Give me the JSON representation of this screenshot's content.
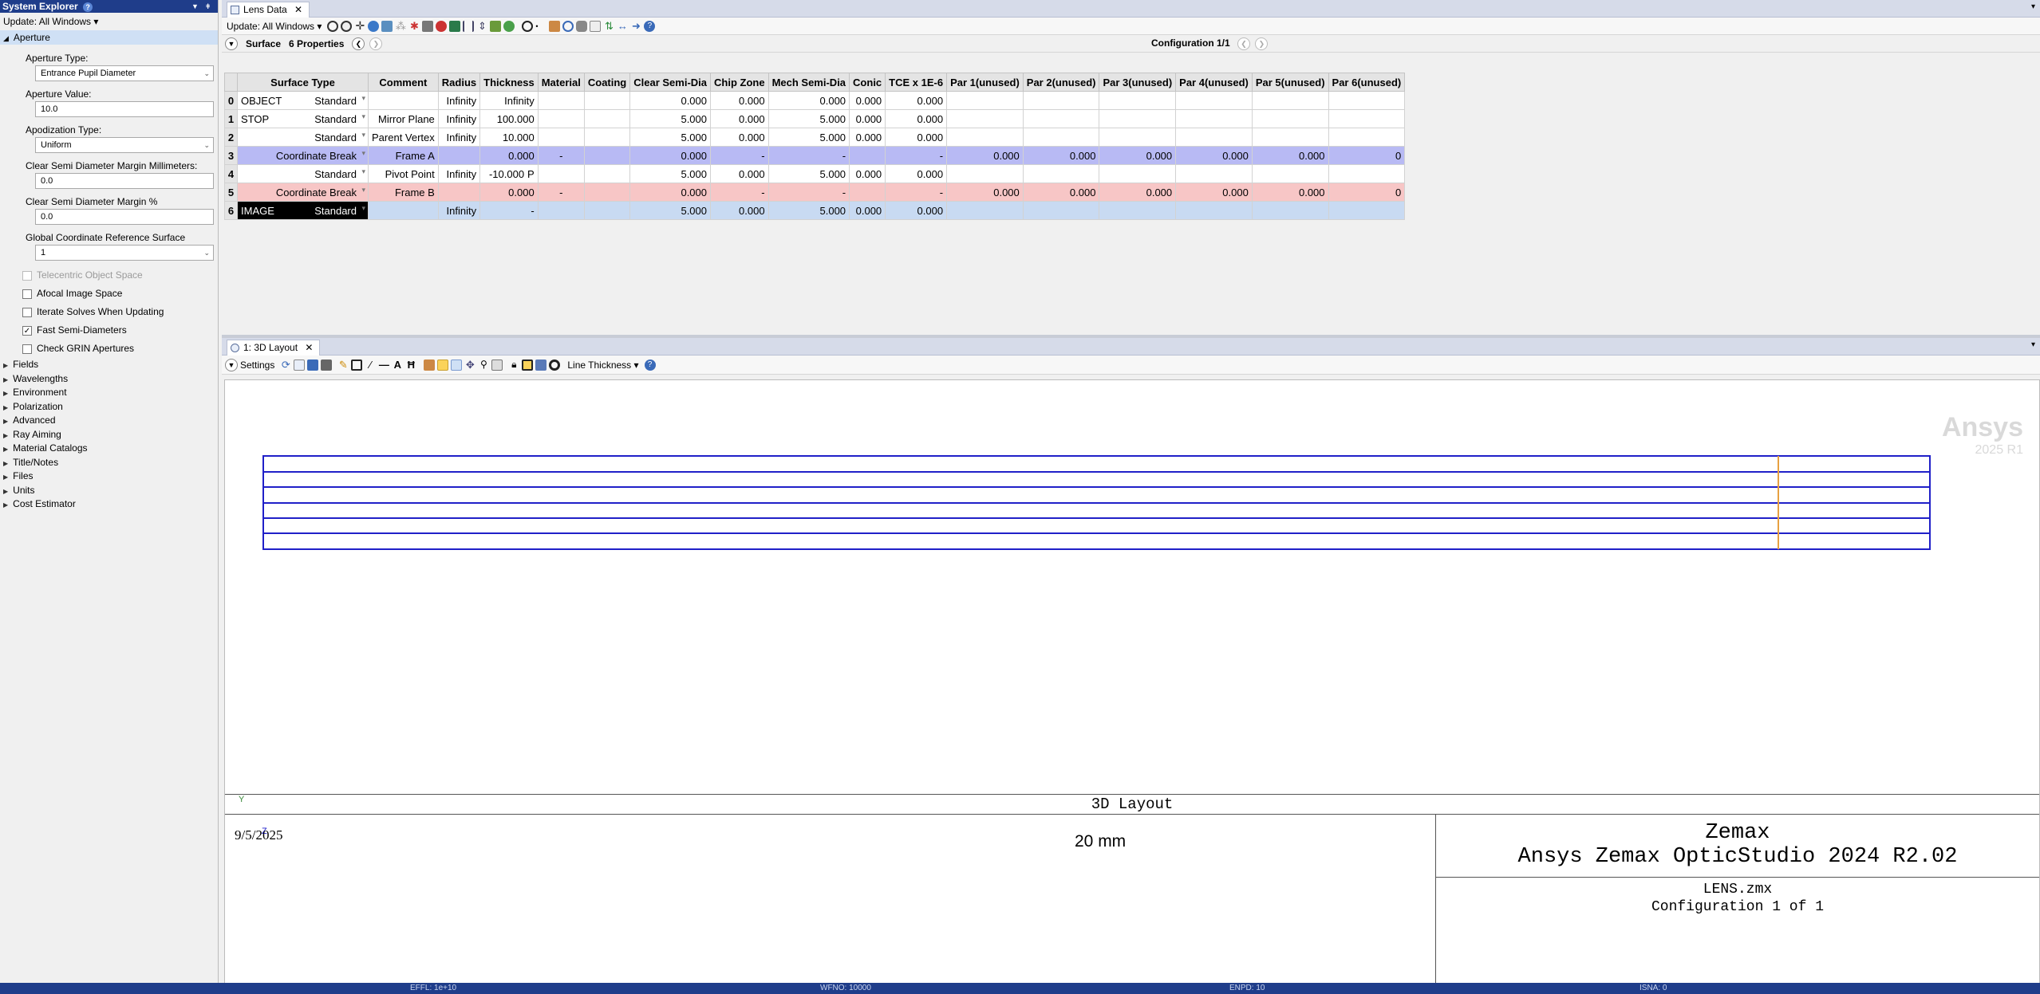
{
  "explorer": {
    "title": "System Explorer",
    "update_label": "Update: All Windows ▾",
    "aperture_section": "Aperture",
    "fields": [
      {
        "label": "Aperture Type:",
        "value": "Entrance Pupil Diameter",
        "dropdown": true
      },
      {
        "label": "Aperture Value:",
        "value": "10.0",
        "dropdown": false
      },
      {
        "label": "Apodization Type:",
        "value": "Uniform",
        "dropdown": true
      },
      {
        "label": "Clear Semi Diameter Margin Millimeters:",
        "value": "0.0",
        "dropdown": false
      },
      {
        "label": "Clear Semi Diameter Margin %",
        "value": "0.0",
        "dropdown": false
      },
      {
        "label": "Global Coordinate Reference Surface",
        "value": "1",
        "dropdown": true
      }
    ],
    "checks": [
      {
        "label": "Telecentric Object Space",
        "checked": false,
        "disabled": true
      },
      {
        "label": "Afocal Image Space",
        "checked": false,
        "disabled": false
      },
      {
        "label": "Iterate Solves When Updating",
        "checked": false,
        "disabled": false
      },
      {
        "label": "Fast Semi-Diameters",
        "checked": true,
        "disabled": false
      },
      {
        "label": "Check GRIN Apertures",
        "checked": false,
        "disabled": false
      }
    ],
    "tree": [
      "Fields",
      "Wavelengths",
      "Environment",
      "Polarization",
      "Advanced",
      "Ray Aiming",
      "Material Catalogs",
      "Title/Notes",
      "Files",
      "Units",
      "Cost Estimator"
    ]
  },
  "lens": {
    "tab_label": "Lens Data",
    "update_label": "Update: All Windows ▾",
    "surface_label": "Surface",
    "properties_label": "6 Properties",
    "configuration_label": "Configuration 1/1",
    "columns": [
      "Surface Type",
      "Comment",
      "Radius",
      "Thickness",
      "Material",
      "Coating",
      "Clear Semi-Dia",
      "Chip Zone",
      "Mech Semi-Dia",
      "Conic",
      "TCE x 1E-6",
      "Par 1(unused)",
      "Par 2(unused)",
      "Par 3(unused)",
      "Par 4(unused)",
      "Par 5(unused)",
      "Par 6(unused)"
    ],
    "rows": [
      {
        "num": "0",
        "name": "OBJECT",
        "type": "Standard",
        "comment": "",
        "radius": "Infinity",
        "thickness": "Infinity",
        "material": "",
        "coating": "",
        "csd": "0.000",
        "chip": "0.000",
        "msd": "0.000",
        "conic": "0.000",
        "tce": "0.000",
        "p1": "",
        "p2": "",
        "p3": "",
        "p4": "",
        "p5": "",
        "p6": ""
      },
      {
        "num": "1",
        "name": "STOP",
        "type": "Standard",
        "comment": "Mirror Plane",
        "radius": "Infinity",
        "thickness": "100.000",
        "material": "",
        "coating": "",
        "csd": "5.000",
        "chip": "0.000",
        "msd": "5.000",
        "conic": "0.000",
        "tce": "0.000",
        "p1": "",
        "p2": "",
        "p3": "",
        "p4": "",
        "p5": "",
        "p6": ""
      },
      {
        "num": "2",
        "name": "",
        "type": "Standard",
        "comment": "Parent Vertex",
        "radius": "Infinity",
        "thickness": "10.000",
        "material": "",
        "coating": "",
        "csd": "5.000",
        "chip": "0.000",
        "msd": "5.000",
        "conic": "0.000",
        "tce": "0.000",
        "p1": "",
        "p2": "",
        "p3": "",
        "p4": "",
        "p5": "",
        "p6": ""
      },
      {
        "num": "3",
        "name": "",
        "type": "Coordinate Break",
        "comment": "Frame A",
        "radius": "",
        "thickness": "0.000",
        "material": "-",
        "coating": "",
        "csd": "0.000",
        "chip": "-",
        "msd": "-",
        "conic": "",
        "tce": "-",
        "p1": "0.000",
        "p2": "0.000",
        "p3": "0.000",
        "p4": "0.000",
        "p5": "0.000",
        "p6": "0"
      },
      {
        "num": "4",
        "name": "",
        "type": "Standard",
        "comment": "Pivot Point",
        "radius": "Infinity",
        "thickness": "-10.000",
        "thickness_solve": "P",
        "material": "",
        "coating": "",
        "csd": "5.000",
        "chip": "0.000",
        "msd": "5.000",
        "conic": "0.000",
        "tce": "0.000",
        "p1": "",
        "p2": "",
        "p3": "",
        "p4": "",
        "p5": "",
        "p6": ""
      },
      {
        "num": "5",
        "name": "",
        "type": "Coordinate Break",
        "comment": "Frame B",
        "radius": "",
        "thickness": "0.000",
        "material": "-",
        "coating": "",
        "csd": "0.000",
        "chip": "-",
        "msd": "-",
        "conic": "",
        "tce": "-",
        "p1": "0.000",
        "p2": "0.000",
        "p3": "0.000",
        "p4": "0.000",
        "p5": "0.000",
        "p6": "0"
      },
      {
        "num": "6",
        "name": "IMAGE",
        "type": "Standard",
        "comment": "",
        "radius": "Infinity",
        "thickness": "-",
        "material": "",
        "coating": "",
        "csd": "5.000",
        "chip": "0.000",
        "msd": "5.000",
        "conic": "0.000",
        "tce": "0.000",
        "p1": "",
        "p2": "",
        "p3": "",
        "p4": "",
        "p5": "",
        "p6": ""
      }
    ]
  },
  "layout": {
    "tab_label": "1: 3D Layout",
    "settings_label": "Settings",
    "line_thickness_label": "Line Thickness ▾",
    "watermark_brand": "Ansys",
    "watermark_version": "2025 R1",
    "axis_y": "Y",
    "axis_z": "Z",
    "scale_label": "20 mm",
    "caption": "3D Layout",
    "date": "9/5/2025",
    "product_line1": "Zemax",
    "product_line2": "Ansys Zemax OpticStudio 2024 R2.02",
    "file_name": "LENS.zmx",
    "configuration": "Configuration 1 of 1"
  },
  "status": {
    "effl": "EFFL: 1e+10",
    "wfno": "WFNO: 10000",
    "enpd": "ENPD: 10",
    "isna": "ISNA: 0"
  },
  "colors": {
    "ray_lines": "#2020c8",
    "surface_marker": "#e8a040",
    "cb_row_a": "#b8baf4",
    "cb_row_b": "#f7c6c6",
    "title_bar": "#1f3d8a"
  }
}
